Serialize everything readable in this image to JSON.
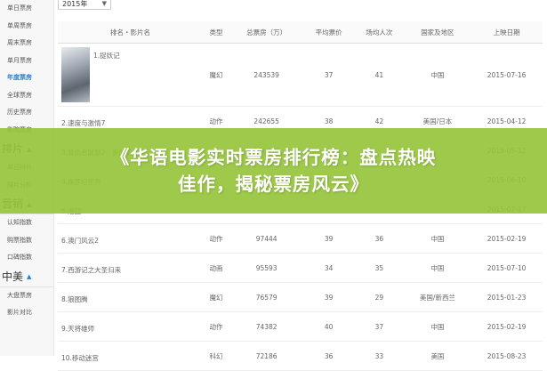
{
  "year_select": {
    "value": "2015年"
  },
  "sidebar": {
    "top_items": [
      "单日票房",
      "单周票房",
      "周末票房",
      "单月票房",
      "年度票房",
      "全球票房",
      "历史票房",
      "影院票房"
    ],
    "active_index": 4,
    "sections": [
      {
        "title": "排片",
        "items": [
          "单日排片",
          "排片分析"
        ]
      },
      {
        "title": "营销",
        "items": [
          "认知指数",
          "购票指数",
          "口碑指数"
        ]
      },
      {
        "title": "中美",
        "items": [
          "大盘票房",
          "影片对比"
        ]
      }
    ]
  },
  "table": {
    "headers": [
      "排名・影片名",
      "类型",
      "总票房（万）",
      "平均票价",
      "场均人次",
      "国家及地区",
      "上映日期"
    ],
    "rows": [
      {
        "film": "1.捉妖记",
        "type": "魔幻",
        "gross": "243539",
        "price": "37",
        "avg": "41",
        "region": "中国",
        "date": "2015-07-16"
      },
      {
        "film": "2.速度与激情7",
        "type": "动作",
        "gross": "242655",
        "price": "38",
        "avg": "42",
        "region": "美国/日本",
        "date": "2015-04-12"
      },
      {
        "film": "3.复仇者联盟2：奥创纪元",
        "type": "",
        "gross": "146419",
        "price": "",
        "avg": "",
        "region": "",
        "date": "2015-05-12"
      },
      {
        "film": "4.侏罗纪世界",
        "type": "",
        "gross": "",
        "price": "",
        "avg": "",
        "region": "",
        "date": "2015-06-10"
      },
      {
        "film": "5.港囧",
        "type": "",
        "gross": "",
        "price": "",
        "avg": "",
        "region": "",
        "date": "2015-07-17"
      },
      {
        "film": "6.澳门风云2",
        "type": "动作",
        "gross": "97444",
        "price": "39",
        "avg": "36",
        "region": "中国",
        "date": "2015-02-19"
      },
      {
        "film": "7.西游记之大圣归来",
        "type": "动画",
        "gross": "95593",
        "price": "34",
        "avg": "35",
        "region": "中国",
        "date": "2015-07-10"
      },
      {
        "film": "8.狼图腾",
        "type": "魔幻",
        "gross": "76579",
        "price": "39",
        "avg": "29",
        "region": "美国/新西兰",
        "date": "2015-01-23"
      },
      {
        "film": "9.天将雄师",
        "type": "动作",
        "gross": "74382",
        "price": "40",
        "avg": "37",
        "region": "中国",
        "date": "2015-02-19"
      },
      {
        "film": "10.移动迷宫",
        "type": "科幻",
        "gross": "72186",
        "price": "36",
        "avg": "33",
        "region": "美国",
        "date": "2015-08-23"
      }
    ]
  },
  "banner": {
    "line1": "《华语电影实时票房排行榜：盘点热映",
    "line2": "佳作，揭秘票房风云》"
  }
}
